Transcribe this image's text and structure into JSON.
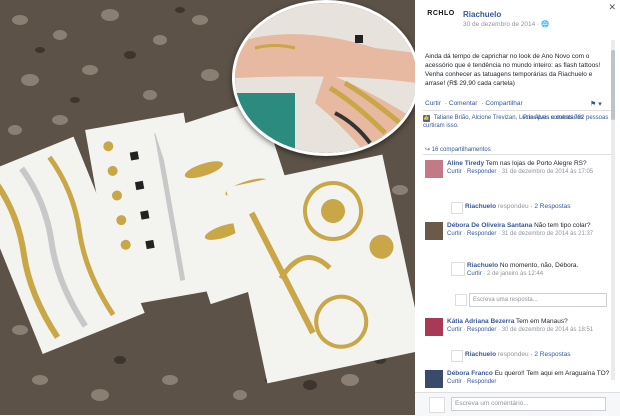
{
  "post": {
    "page_name": "Riachuelo",
    "date": "30 de dezembro de 2014 · ",
    "logo_text": "RCHLO",
    "close_glyph": "✕",
    "caption": "Ainda dá tempo de caprichar no look de Ano Novo com o acessório que é tendência no mundo inteiro: as flash tattoos! Venha conhecer as tatuagens temporárias da Riachuelo e arrase! (R$ 29,90 cada cartela)",
    "actions": {
      "like": "Curtir",
      "comment": "Comentar",
      "share": "Compartilhar"
    },
    "likes_text": "Tatiane Brião, Alcione Trevizan, Lucia Alves e outras 782 pessoas curtiram isso.",
    "likes_sort": "Principais comentários",
    "shares_text": "16 compartilhamentos"
  },
  "comments": [
    {
      "author": "Aline Tiredy",
      "text": "Tem nas lojas de Porto Alegre RS?",
      "meta_like": "Curtir",
      "meta_reply": "Responder",
      "meta_date": "31 de dezembro de 2014 às 17:05",
      "reply_author": "Riachuelo",
      "reply_label": "respondeu",
      "reply_count": "2 Respostas"
    },
    {
      "author": "Débora De Oliveira Santana",
      "text": "Não tem tipo colar?",
      "meta_like": "Curtir",
      "meta_reply": "Responder",
      "meta_date": "31 de dezembro de 2014 às 21:37",
      "reply_author": "Riachuelo",
      "reply_text": "No momento, não, Débora.",
      "reply_meta_like": "Curtir",
      "reply_meta_date": "2 de janeiro às 12:44",
      "reply_placeholder": "Escreva uma resposta..."
    },
    {
      "author": "Kátia Adriana Bezerra",
      "text": "Tem em Manaus?",
      "meta_like": "Curtir",
      "meta_reply": "Responder",
      "meta_date": "30 de dezembro de 2014 às 18:51",
      "reply_author": "Riachuelo",
      "reply_label": "respondeu",
      "reply_count": "2 Respostas"
    },
    {
      "author": "Débora Franco",
      "text": "Eu quero!! Tem aqui em Araguaína TO?",
      "meta_like": "Curtir",
      "meta_reply": "Responder"
    }
  ],
  "footer": {
    "comment_placeholder": "Escreva um comentário..."
  },
  "colors": {
    "link": "#365899",
    "gold": "#c9a646",
    "silver": "#c8c8c8",
    "pebble_bg": "#5c5247"
  }
}
